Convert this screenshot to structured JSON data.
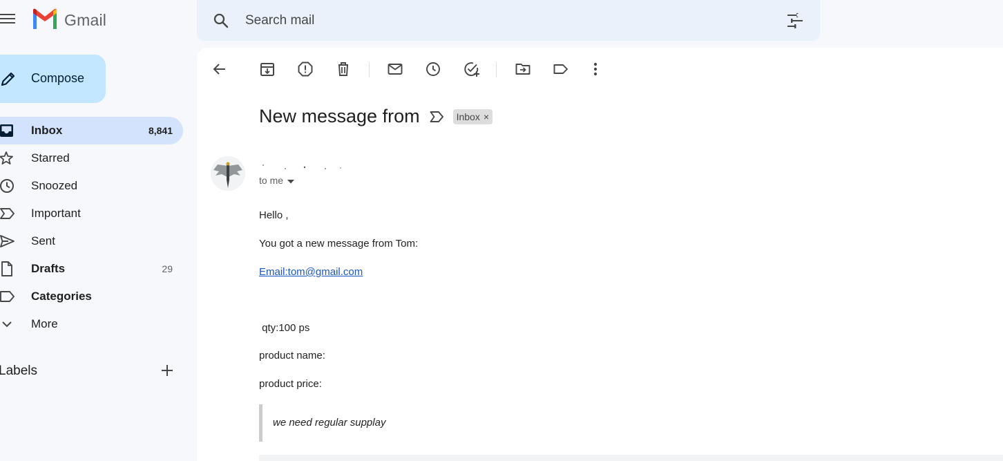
{
  "app": {
    "name": "Gmail",
    "brand_colors": {
      "red": "#ea4335",
      "blue": "#4285f4",
      "green": "#34a853",
      "yellow": "#fbbc04"
    }
  },
  "header": {
    "menu_icon": "hamburger-menu-icon",
    "search": {
      "placeholder": "Search mail",
      "icon": "search-icon",
      "filter_icon": "tune-icon"
    }
  },
  "sidebar": {
    "compose_label": "Compose",
    "items": [
      {
        "label": "Inbox",
        "count": "8,841",
        "icon": "inbox-icon",
        "active": true,
        "bold": true
      },
      {
        "label": "Starred",
        "count": "",
        "icon": "star-icon"
      },
      {
        "label": "Snoozed",
        "count": "",
        "icon": "clock-icon"
      },
      {
        "label": "Important",
        "count": "",
        "icon": "important-icon"
      },
      {
        "label": "Sent",
        "count": "",
        "icon": "send-icon"
      },
      {
        "label": "Drafts",
        "count": "29",
        "icon": "draft-icon",
        "bold": true
      },
      {
        "label": "Categories",
        "count": "",
        "icon": "label-icon",
        "bold": true
      },
      {
        "label": "More",
        "count": "",
        "icon": "chevron-down-icon"
      }
    ],
    "labels_title": "Labels"
  },
  "toolbar": {
    "icons": [
      "back-arrow-icon",
      "archive-icon",
      "report-spam-icon",
      "delete-icon",
      "mark-unread-icon",
      "snooze-icon",
      "add-task-icon",
      "move-to-icon",
      "label-icon",
      "more-vert-icon"
    ]
  },
  "message": {
    "subject": "New message from",
    "label_chip": "Inbox",
    "chip_close": "×",
    "recipient": "to me",
    "body": {
      "greeting": "Hello ,",
      "intro": "You got a new message from Tom:",
      "email_link": "Email:tom@gmail.com",
      "qty": " qty:100 ps",
      "product_name": "product name:",
      "product_price": "product price:",
      "quote": "we need regular supplay"
    }
  }
}
